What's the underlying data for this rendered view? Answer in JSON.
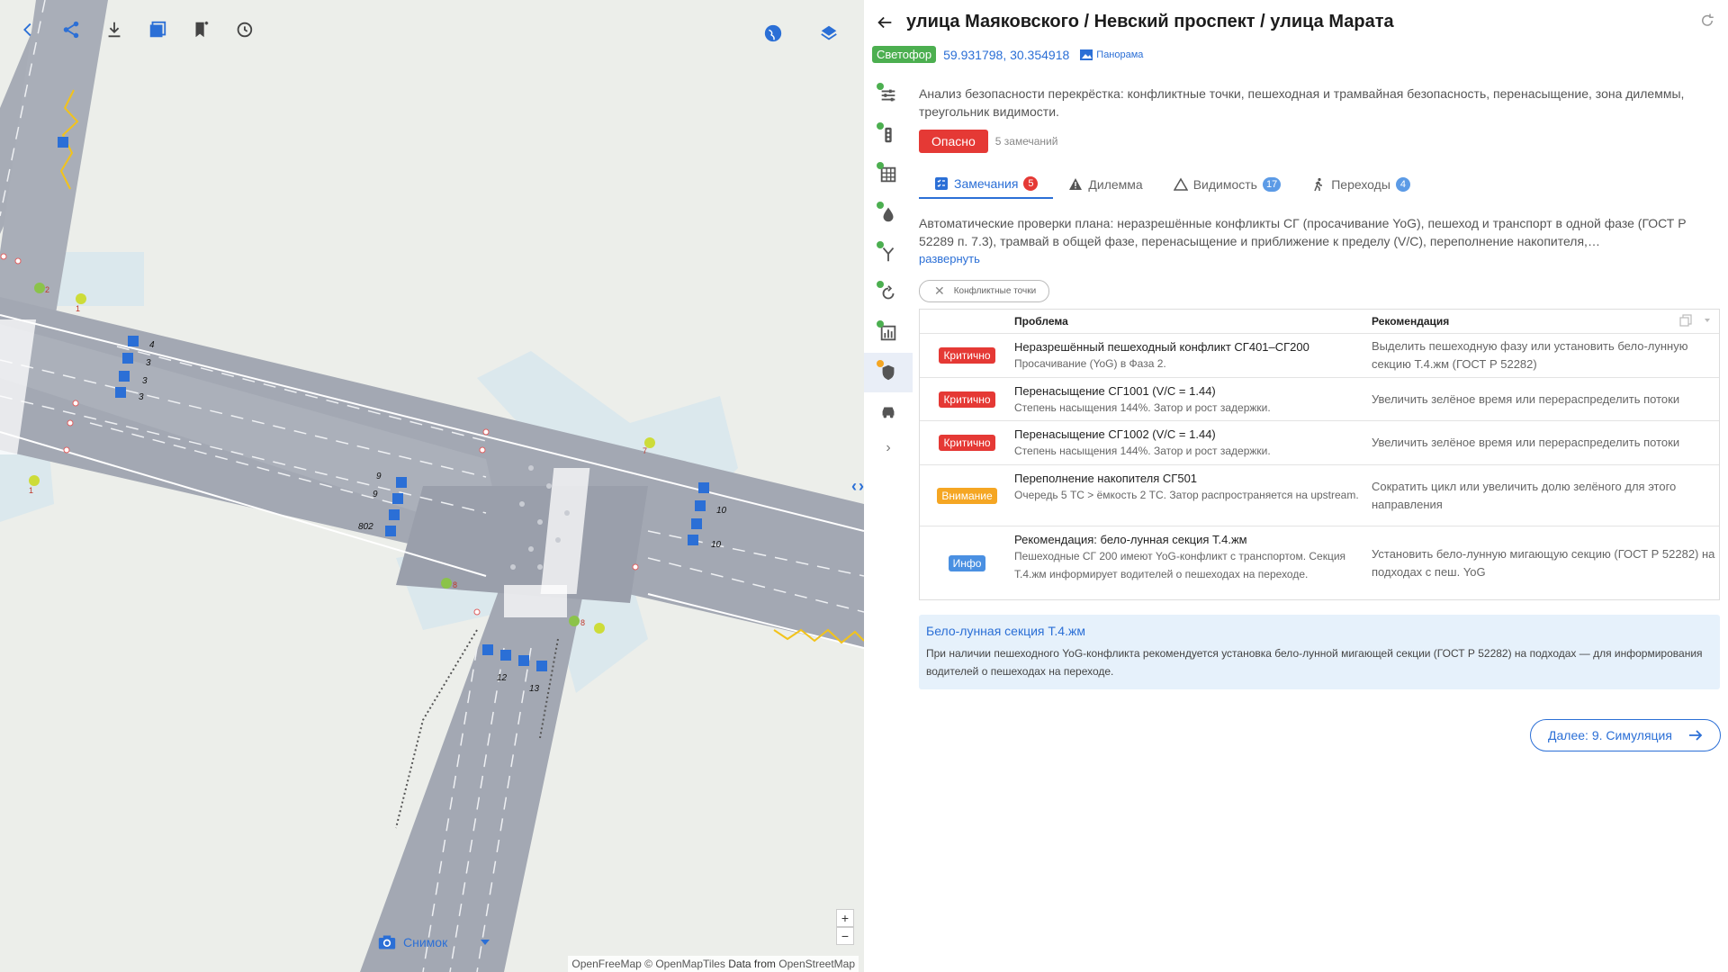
{
  "header": {
    "title": "улица Маяковского / Невский проспект / улица Марата",
    "type_tag": "Светофор",
    "coords": "59.931798, 30.354918",
    "panorama_label": "Панорама"
  },
  "description": "Анализ безопасности перекрёстка: конфликтные точки, пешеходная и трамвайная безопасность, перенасыщение, зона дилеммы, треугольник видимости.",
  "status": {
    "label": "Опасно",
    "remarks": "5 замечаний"
  },
  "tabs": [
    {
      "label": "Замечания",
      "count": "5",
      "icon": "checklist-icon"
    },
    {
      "label": "Дилемма",
      "icon": "warning-icon"
    },
    {
      "label": "Видимость",
      "count": "17",
      "icon": "triangle-icon"
    },
    {
      "label": "Переходы",
      "count": "4",
      "icon": "pedestrian-icon"
    }
  ],
  "checks_desc": "Автоматические проверки плана: неразрешённые конфликты СГ (просачивание YoG), пешеход и транспорт в одной фазе (ГОСТ Р 52289 п. 7.3), трамвай в общей фазе, перенасыщение и приближение к пределу (V/C), переполнение накопителя,…",
  "expand_label": "развернуть",
  "chip_label": "Конфликтные точки",
  "table": {
    "col_problem": "Проблема",
    "col_rec": "Рекомендация",
    "rows": [
      {
        "severity": "Критично",
        "level": "crit",
        "title": "Неразрешённый пешеходный конфликт СГ401–СГ200",
        "sub": "Просачивание (YoG) в Фаза 2.",
        "rec": "Выделить пешеходную фазу или установить бело-лунную секцию Т.4.жм (ГОСТ Р 52282)"
      },
      {
        "severity": "Критично",
        "level": "crit",
        "title": "Перенасыщение СГ1001 (V/C = 1.44)",
        "sub": "Степень насыщения 144%. Затор и рост задержки.",
        "rec": "Увеличить зелёное время или перераспределить потоки"
      },
      {
        "severity": "Критично",
        "level": "crit",
        "title": "Перенасыщение СГ1002 (V/C = 1.44)",
        "sub": "Степень насыщения 144%. Затор и рост задержки.",
        "rec": "Увеличить зелёное время или перераспределить потоки"
      },
      {
        "severity": "Внимание",
        "level": "warn",
        "title": "Переполнение накопителя СГ501",
        "sub": "Очередь 5 ТС > ёмкость 2 ТС. Затор распространяется на upstream.",
        "rec": "Сократить цикл или увеличить долю зелёного для этого направления"
      },
      {
        "severity": "Инфо",
        "level": "info",
        "title": "Рекомендация: бело-лунная секция Т.4.жм",
        "sub": "Пешеходные СГ 200 имеют YoG-конфликт с транспортом. Секция Т.4.жм информирует водителей о пешеходах на переходе.",
        "rec": "Установить бело-лунную мигающую секцию (ГОСТ Р 52282) на подходах с пеш. YoG"
      }
    ]
  },
  "infobox": {
    "title": "Бело-лунная секция Т.4.жм",
    "text": "При наличии пешеходного YoG-конфликта рекомендуется установка бело-лунной мигающей секции (ГОСТ Р 52282) на подходах — для информирования водителей о пешеходах на переходе."
  },
  "next_button": "Далее: 9. Симуляция",
  "map": {
    "snapshot_label": "Снимок",
    "attribution": {
      "a": "OpenFreeMap",
      "b": "© OpenMapTiles",
      "c": "Data from",
      "d": "OpenStreetMap"
    },
    "lane_labels": [
      "4",
      "3",
      "3",
      "3",
      "9",
      "9",
      "802",
      "10",
      "10",
      "12",
      "13",
      "2",
      "8",
      "8",
      "7",
      "1",
      "1"
    ],
    "zoom_in": "+",
    "zoom_out": "−"
  },
  "colors": {
    "accent": "#2b6fd6",
    "danger": "#e53935",
    "warning": "#f5a623",
    "info": "#4a90e2",
    "success": "#4caf50"
  }
}
